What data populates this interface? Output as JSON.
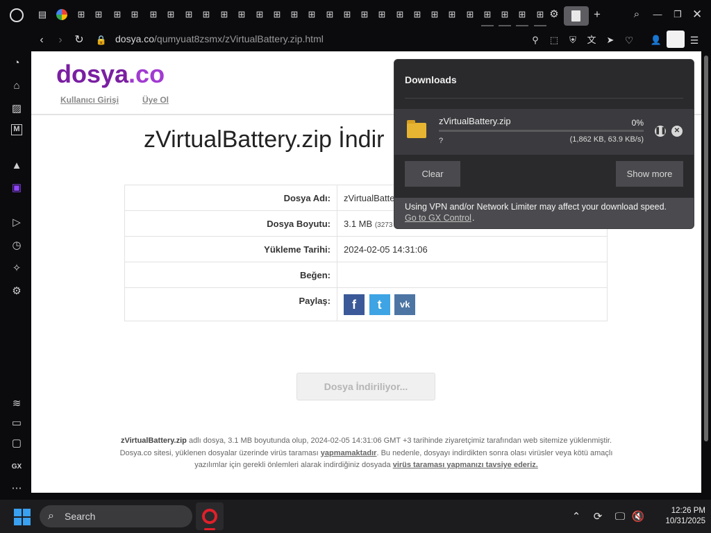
{
  "browser": {
    "url_host": "dosya.co",
    "url_path": "/qumyuat8zsmx/zVirtualBattery.zip.html",
    "tab_icons": [
      "opera-gx-icon",
      "file-icon",
      "google-icon",
      "grid-icon",
      "grid-icon",
      "grid-icon",
      "grid-icon",
      "grid-icon",
      "grid-icon",
      "grid-icon",
      "grid-icon",
      "grid-icon",
      "grid-icon",
      "grid-icon",
      "grid-icon",
      "grid-icon",
      "grid-icon",
      "grid-icon",
      "grid-icon",
      "grid-icon",
      "grid-icon",
      "grid-icon",
      "grid-icon",
      "gear-icon",
      "file-icon",
      "plus-icon"
    ]
  },
  "site": {
    "logo_main": "dosya",
    "logo_dot": ".co",
    "link_login": "Kullanıcı Girişi",
    "link_register": "Üye Ol",
    "heading": "zVirtualBattery.zip İndir",
    "rows": [
      {
        "label": "Dosya Adı:",
        "value": "zVirtualBattery.zip"
      },
      {
        "label": "Dosya Boyutu:",
        "value": "3.1 MB",
        "detail": "(3273"
      },
      {
        "label": "Yükleme Tarihi:",
        "value": "2024-02-05 14:31:06"
      },
      {
        "label": "Beğen:",
        "value": ""
      },
      {
        "label": "Paylaş:",
        "value": ""
      }
    ],
    "share": {
      "facebook": "f",
      "twitter": "t",
      "vk": "vk",
      "facebook_color": "#3b5998",
      "twitter_color": "#3ea4e4",
      "vk_color": "#4c75a3"
    },
    "download_button": "Dosya İndiriliyor...",
    "footnote": {
      "file": "zVirtualBattery.zip",
      "t1": " adlı dosya, 3.1 MB boyutunda olup, 2024-02-05 14:31:06 GMT +3 tarihinde ziyaretçimiz tarafından web sitemize yüklenmiştir. Dosya.co sitesi, yüklenen dosyalar üzerinde virüs taraması ",
      "link1": "yapmamaktadır",
      "t2": ". Bu nedenle, dosyayı indirdikten sonra olası virüsler veya kötü amaçlı yazılımlar için gerekli önlemleri alarak indirdiğiniz dosyada ",
      "link2": "virüs taraması yapmanızı tavsiye ederiz."
    }
  },
  "downloads": {
    "title": "Downloads",
    "filename": "zVirtualBattery.zip",
    "percent": "0%",
    "progress": 0.0,
    "status": "?",
    "size_info": "(1,862 KB, 63.9 KB/s)",
    "clear_label": "Clear",
    "show_more_label": "Show more",
    "notice": "Using VPN and/or Network Limiter may affect your download speed.",
    "notice_link": "Go to GX Control",
    "notice_end": "."
  },
  "taskbar": {
    "search_label": "Search",
    "time": "12:26 PM",
    "date": "10/31/2025"
  }
}
